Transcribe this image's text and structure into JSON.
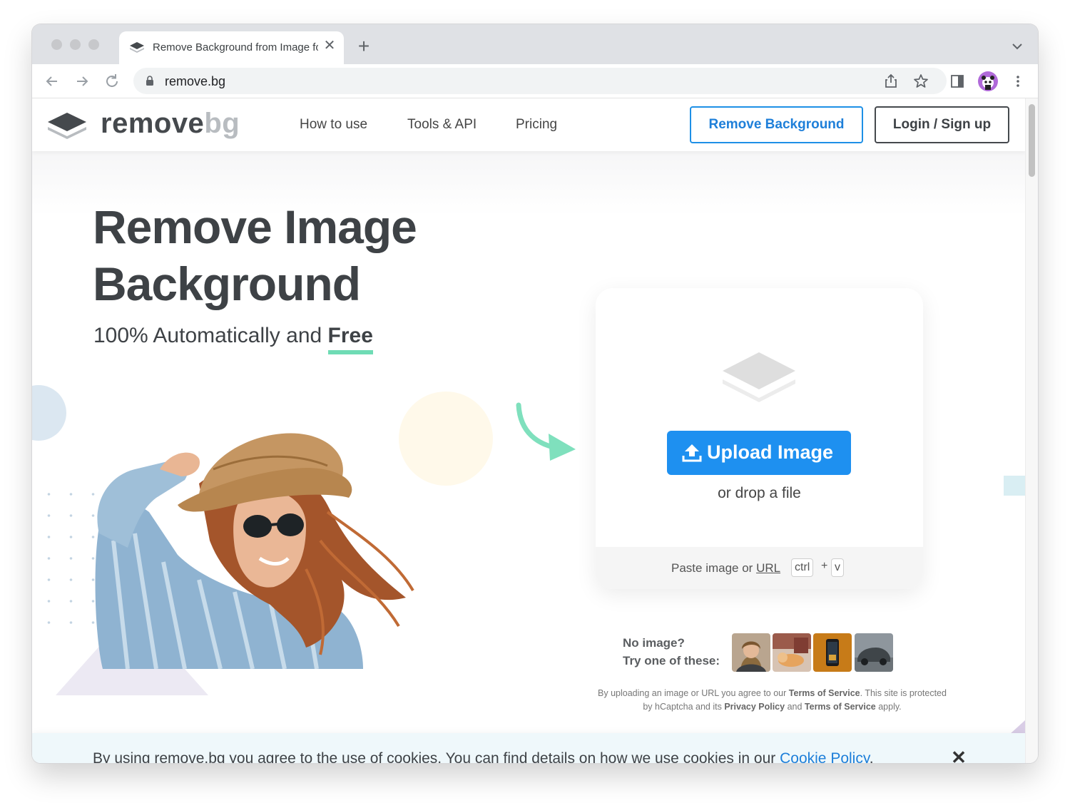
{
  "browser": {
    "tab_title": "Remove Background from Image for Free – remove.bg",
    "tab_close": "✕",
    "new_tab": "+",
    "url": "remove.bg",
    "icons": [
      "back-arrow-icon",
      "forward-arrow-icon",
      "reload-icon",
      "lock-icon",
      "share-icon",
      "star-icon",
      "sidebar-icon",
      "profile-avatar",
      "menu-dots-icon",
      "tab-list-chevron-icon"
    ]
  },
  "header": {
    "logo_word1": "remove",
    "logo_word2": "bg",
    "nav": [
      "How to use",
      "Tools & API",
      "Pricing"
    ],
    "remove_button": "Remove Background",
    "login_button": "Login / Sign up"
  },
  "hero": {
    "title_line1": "Remove Image",
    "title_line2": "Background",
    "subtitle_prefix": "100% Automatically and ",
    "subtitle_emphasis": "Free"
  },
  "upload": {
    "button_label": "Upload Image",
    "drop_text": "or drop a file",
    "paste_prefix": "Paste image or ",
    "paste_link": "URL",
    "key1": "ctrl",
    "key_plus": "+",
    "key2": "v"
  },
  "samples": {
    "line1": "No image?",
    "line2": "Try one of these:",
    "items": [
      "sample-woman",
      "sample-cat",
      "sample-phone",
      "sample-car"
    ]
  },
  "legal": {
    "t1": "By uploading an image or URL you agree to our ",
    "b1": "Terms of Service",
    "t2": ". This site is protected by hCaptcha and its ",
    "b2": "Privacy Policy",
    "t3": " and ",
    "b3": "Terms of Service",
    "t4": " apply."
  },
  "cookie": {
    "text": "By using remove.bg you agree to the use of cookies. You can find details on how we use cookies in our ",
    "link": "Cookie Policy",
    "end": ".",
    "close": "✕"
  },
  "colors": {
    "accent_blue": "#1e90f0",
    "underline_green": "#6fdcb5",
    "text_dark": "#3e4246"
  }
}
